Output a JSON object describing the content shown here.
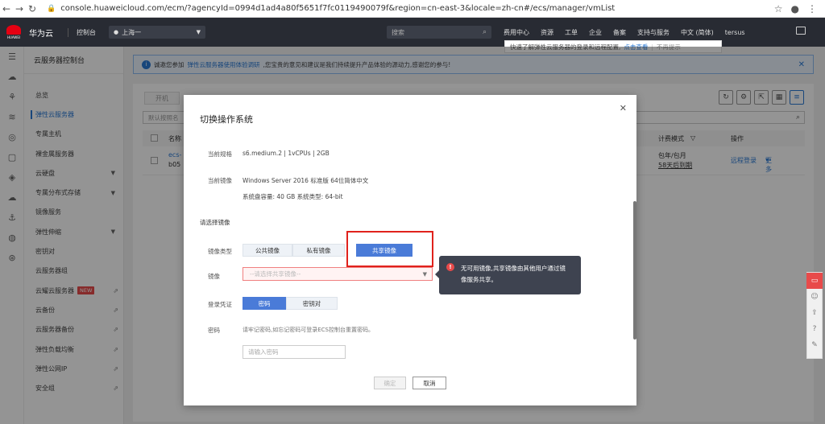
{
  "browser": {
    "url": "console.huaweicloud.com/ecm/?agencyId=0994d1ad4a80f5651f7fc0119490079f&region=cn-east-3&locale=zh-cn#/ecs/manager/vmList"
  },
  "topnav": {
    "logo_text": "HUAWEI",
    "brand": "华为云",
    "console": "控制台",
    "region": "上海一",
    "search_placeholder": "搜索",
    "links": [
      "费用中心",
      "资源",
      "工单",
      "企业",
      "备案",
      "支持与服务",
      "中文 (简体)",
      "tersus"
    ]
  },
  "tip": {
    "text": "快速了解弹性云服务器的登录和远程配置,",
    "link": "点击查看",
    "dismiss": "不再提示"
  },
  "sidebar": {
    "title": "云服务器控制台",
    "items": [
      {
        "label": "总览"
      },
      {
        "label": "弹性云服务器"
      },
      {
        "label": "专属主机"
      },
      {
        "label": "裸金属服务器"
      },
      {
        "label": "云硬盘"
      },
      {
        "label": "专属分布式存储"
      },
      {
        "label": "镜像服务"
      },
      {
        "label": "弹性伸缩"
      },
      {
        "label": "密钥对"
      },
      {
        "label": "云服务器组"
      },
      {
        "label": "云耀云服务器",
        "badge": "NEW"
      },
      {
        "label": "云备份"
      },
      {
        "label": "云服务器备份"
      },
      {
        "label": "弹性负载均衡"
      },
      {
        "label": "弹性公网IP"
      },
      {
        "label": "安全组"
      }
    ]
  },
  "notice": {
    "prefix": "诚邀您参加",
    "link": "弹性云服务器使用体验调研",
    "suffix": ",您宝贵的意见和建议是我们持续提升产品体验的源动力,感谢您的参与!"
  },
  "list": {
    "start_btn": "开机",
    "filter_placeholder": "默认按照名",
    "col_name": "名称",
    "col_billing": "计费模式",
    "col_ops": "操作",
    "row_name": "ecs-",
    "row_id": "b05",
    "row_billing": "包年/包月",
    "row_expire": "58天后到期",
    "row_remote": "远程登录",
    "row_more": "更多"
  },
  "modal": {
    "title": "切换操作系统",
    "spec_label": "当前规格",
    "spec_value": "s6.medium.2 | 1vCPUs | 2GB",
    "image_label": "当前镜像",
    "image_value": "Windows Server 2016 标准版 64位简体中文",
    "disk_value": "系统盘容量: 40 GB   系统类型: 64-bit",
    "section": "请选择镜像",
    "type_label": "镜像类型",
    "types": [
      "公共镜像",
      "私有镜像",
      "共享镜像"
    ],
    "mirror_label": "镜像",
    "mirror_placeholder": "--请选择共享镜像--",
    "cred_label": "登录凭证",
    "creds": [
      "密码",
      "密钥对"
    ],
    "pw_label": "密码",
    "pw_hint": "请牢记密码,如忘记密码可登录ECS控制台重置密码。",
    "pw_placeholder": "请输入密码",
    "ok": "确定",
    "cancel": "取消"
  },
  "tooltip": {
    "line1": "无可用镜像,共享镜像由其他用户通过镜",
    "line2": "像服务共享。"
  }
}
